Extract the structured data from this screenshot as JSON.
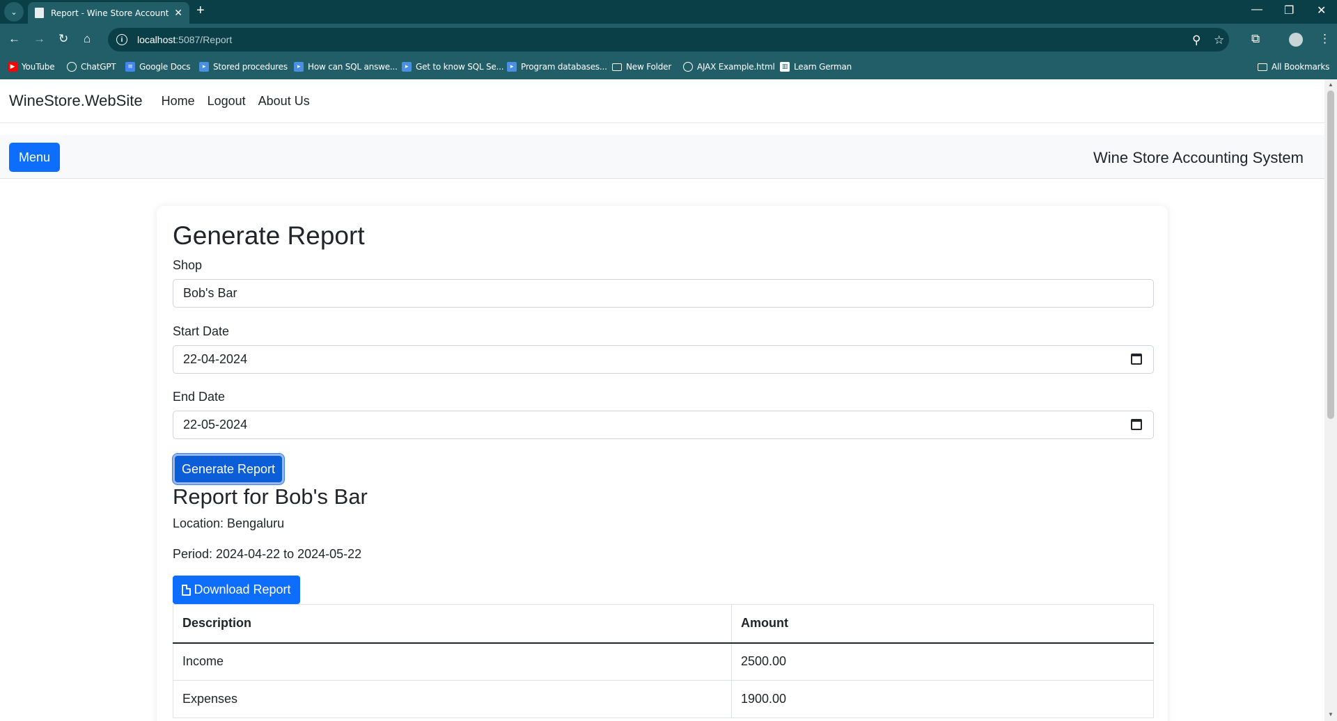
{
  "browser": {
    "tab_title": "Report - Wine Store Accounting",
    "url_host": "localhost",
    "url_path": ":5087/Report",
    "bookmarks": [
      {
        "label": "YouTube",
        "icon": "youtube-icon",
        "color": "#ff0000"
      },
      {
        "label": "ChatGPT",
        "icon": "chatgpt-icon",
        "color": "#ffffff"
      },
      {
        "label": "Google Docs",
        "icon": "docs-icon",
        "color": "#4285f4"
      },
      {
        "label": "Stored procedures",
        "icon": "bookmark-arrow-icon",
        "color": "#4a90e2"
      },
      {
        "label": "How can SQL answe...",
        "icon": "bookmark-arrow-icon",
        "color": "#4a90e2"
      },
      {
        "label": "Get to know SQL Se...",
        "icon": "bookmark-arrow-icon",
        "color": "#4a90e2"
      },
      {
        "label": "Program databases...",
        "icon": "bookmark-arrow-icon",
        "color": "#4a90e2"
      },
      {
        "label": "New Folder",
        "icon": "folder-icon",
        "color": "#ffffff"
      },
      {
        "label": "AJAX Example.html",
        "icon": "globe-icon",
        "color": "#ffffff"
      },
      {
        "label": "Learn German",
        "icon": "learn-icon",
        "color": "#ffffff"
      }
    ],
    "all_bookmarks": "All Bookmarks"
  },
  "navbar": {
    "brand": "WineStore.WebSite",
    "links": [
      "Home",
      "Logout",
      "About Us"
    ]
  },
  "subbar": {
    "menu_label": "Menu",
    "system_title": "Wine Store Accounting System"
  },
  "form": {
    "heading": "Generate Report",
    "shop_label": "Shop",
    "shop_value": "Bob's Bar",
    "start_label": "Start Date",
    "start_value": "22-04-2024",
    "end_label": "End Date",
    "end_value": "22-05-2024",
    "generate_label": "Generate Report"
  },
  "report": {
    "title": "Report for Bob's Bar",
    "location": "Location: Bengaluru",
    "period": "Period: 2024-04-22 to 2024-05-22",
    "download_label": "Download Report",
    "columns": [
      "Description",
      "Amount"
    ],
    "rows": [
      {
        "description": "Income",
        "amount": "2500.00"
      },
      {
        "description": "Expenses",
        "amount": "1900.00"
      }
    ]
  },
  "colors": {
    "chrome_dark": "#0b3f47",
    "chrome": "#215e67",
    "primary": "#0d6efd"
  }
}
